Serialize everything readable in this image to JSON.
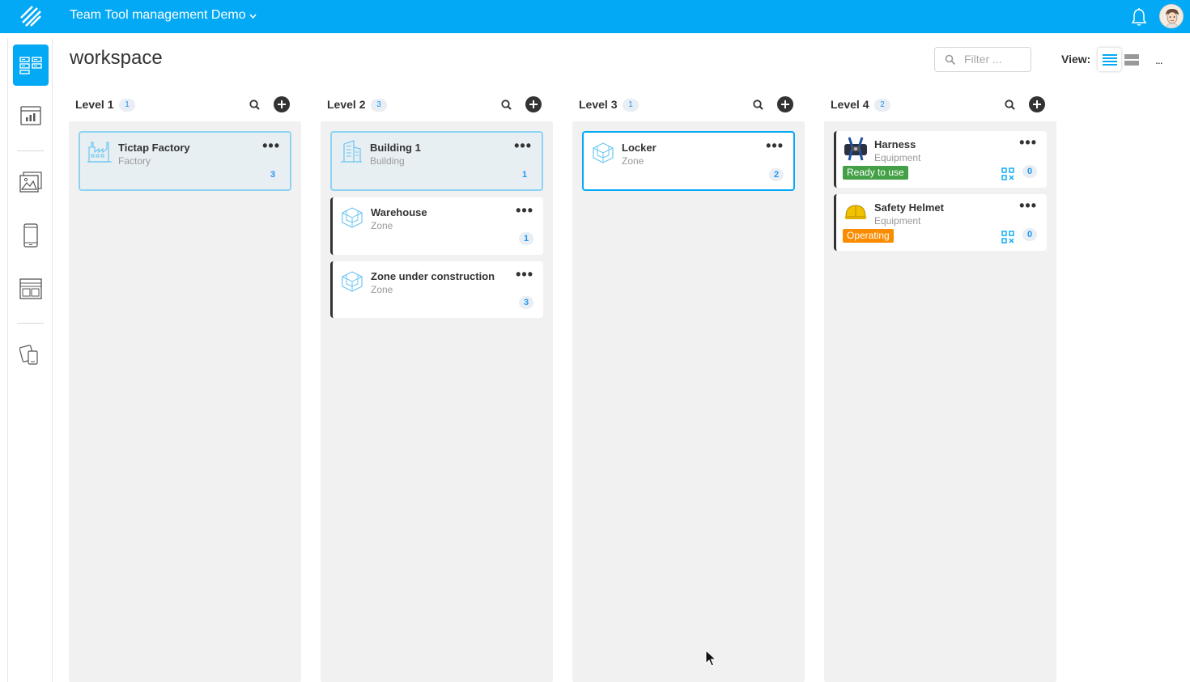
{
  "app": {
    "title": "Team Tool management Demo"
  },
  "colors": {
    "brand": "#03a9f4",
    "ready": "#43a047",
    "operating": "#fb8c00"
  },
  "header": {
    "page_title": "workspace",
    "filter_placeholder": "Filter ...",
    "view_label": "View:",
    "more": "..."
  },
  "sidebar": {
    "items": [
      {
        "icon": "workspace-icon",
        "active": true
      },
      {
        "icon": "dashboard-chart-icon"
      },
      {
        "icon": "image-gallery-icon"
      },
      {
        "icon": "mobile-device-icon"
      },
      {
        "icon": "layout-template-icon"
      },
      {
        "icon": "devices-icon"
      }
    ]
  },
  "columns": [
    {
      "title": "Level 1",
      "count": "1",
      "cards": [
        {
          "title": "Tictap Factory",
          "subtitle": "Factory",
          "icon": "factory-icon",
          "badge": "3"
        }
      ]
    },
    {
      "title": "Level 2",
      "count": "3",
      "cards": [
        {
          "title": "Building 1",
          "subtitle": "Building",
          "icon": "building-icon",
          "badge": "1"
        },
        {
          "title": "Warehouse",
          "subtitle": "Zone",
          "icon": "zone-icon",
          "badge": "1"
        },
        {
          "title": "Zone under construction",
          "subtitle": "Zone",
          "icon": "zone-icon",
          "badge": "3"
        }
      ]
    },
    {
      "title": "Level 3",
      "count": "1",
      "cards": [
        {
          "title": "Locker",
          "subtitle": "Zone",
          "icon": "zone-icon",
          "badge": "2"
        }
      ]
    },
    {
      "title": "Level 4",
      "count": "2",
      "cards": [
        {
          "title": "Harness",
          "subtitle": "Equipment",
          "icon": "harness-icon",
          "status": "Ready to use",
          "badge": "0"
        },
        {
          "title": "Safety Helmet",
          "subtitle": "Equipment",
          "icon": "helmet-icon",
          "status": "Operating",
          "badge": "0"
        }
      ]
    }
  ]
}
